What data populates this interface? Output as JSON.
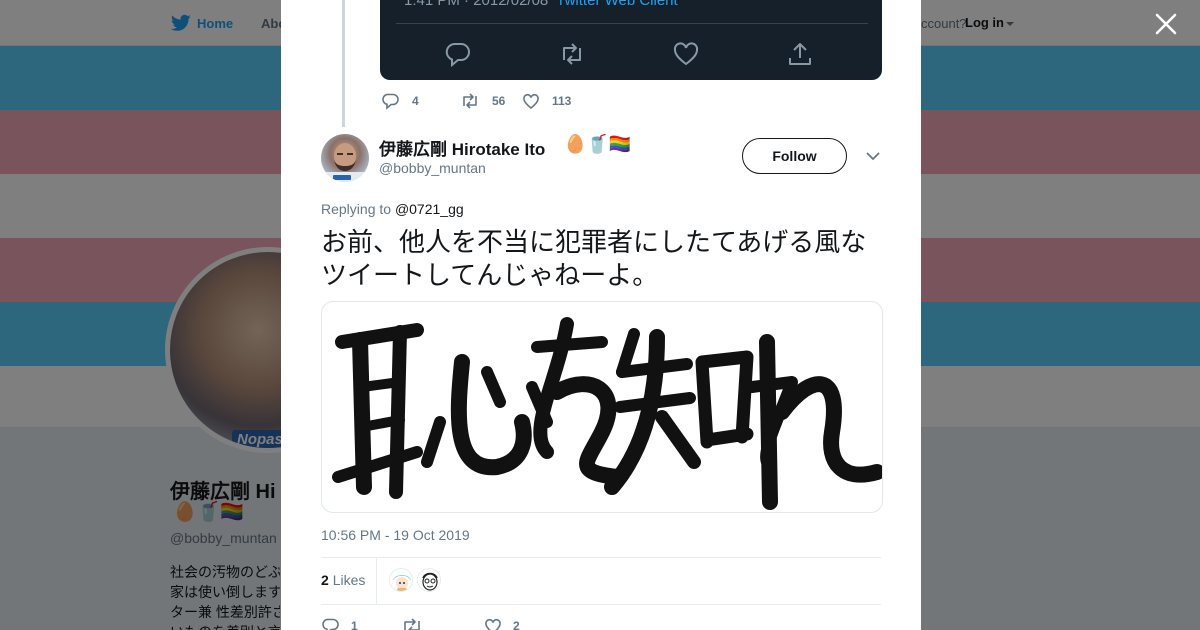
{
  "nav": {
    "home": "Home",
    "about": "Abo",
    "account_prompt": "ccount?",
    "login": "Log in"
  },
  "background_profile": {
    "name": "伊藤広剛 Hi",
    "emoji": "🥚🥤🏳️‍🌈",
    "handle": "@bobby_muntan",
    "bio_lines": [
      "社会の汚物のどぶ",
      "家は使い倒します",
      "ター兼 性差別許さ",
      "いものを差別と言"
    ],
    "avatar_badge": "Nopas",
    "banner_colors": [
      "#5bcefa",
      "#f5a9b8",
      "#ffffff",
      "#f5a9b8",
      "#5bcefa"
    ]
  },
  "quoted_tweet": {
    "meta": "1:41 PM · 2012/02/08",
    "source": "Twitter Web Client",
    "actions": [
      "reply-icon",
      "retweet-icon",
      "like-icon",
      "share-icon"
    ]
  },
  "previous_tweet_stats": {
    "replies": "4",
    "retweets": "56",
    "likes": "113"
  },
  "tweet": {
    "display_name": "伊藤広剛 Hirotake Ito",
    "name_emoji": "🥚🥤🏳️‍🌈",
    "handle": "@bobby_muntan",
    "follow_label": "Follow",
    "replying_prefix": "Replying to",
    "replying_to": "@0721_gg",
    "text": "お前、他人を不当に犯罪者にしたてあげる風なツイートしてんじゃねーよ。",
    "media_alt": "恥を知れ",
    "timestamp": "10:56 PM - 19 Oct 2019",
    "likes_count": "2",
    "likes_label": "Likes",
    "stats": {
      "replies": "1",
      "retweets": "",
      "likes": "2"
    }
  },
  "colors": {
    "accent": "#1da1f2",
    "text": "#14171a",
    "muted": "#657786",
    "like": "#e0245e"
  }
}
